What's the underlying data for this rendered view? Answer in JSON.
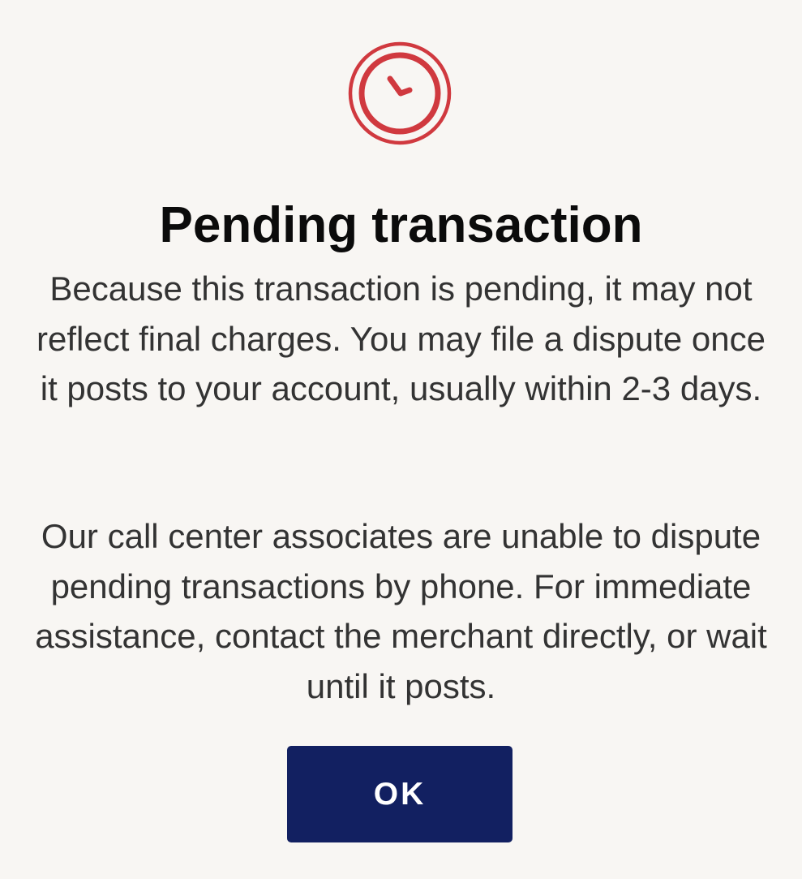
{
  "dialog": {
    "icon": "clock-icon",
    "icon_color": "#d0393f",
    "title": "Pending transaction",
    "paragraphs": [
      "Because this transaction is pending, it may not reflect final charges. You may file a dispute once it posts to your account, usually within 2-3 days.",
      "Our call center associates are unable to dispute pending transactions by phone. For immediate assistance, contact the merchant directly, or wait until it posts."
    ],
    "ok_label": "OK",
    "button_color": "#122061",
    "background_color": "#f8f6f3"
  }
}
